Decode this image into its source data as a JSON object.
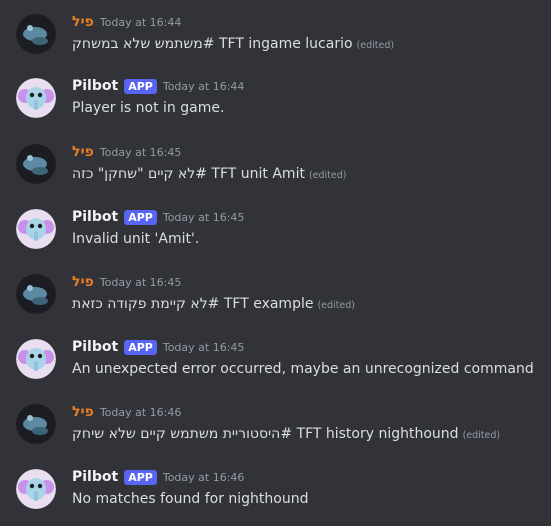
{
  "messages": [
    {
      "author": "פיל",
      "author_type": "user",
      "timestamp": "Today at 16:44",
      "text": "TFT ingame lucario  #משתמש שלא במשחק",
      "edited": "(edited)"
    },
    {
      "author": "Pilbot",
      "author_type": "bot",
      "badge": "APP",
      "timestamp": "Today at 16:44",
      "text": "Player is not in game."
    },
    {
      "author": "פיל",
      "author_type": "user",
      "timestamp": "Today at 16:45",
      "text": "TFT unit Amit    #לא קיים \"שחקן\" כזה",
      "edited": "(edited)"
    },
    {
      "author": "Pilbot",
      "author_type": "bot",
      "badge": "APP",
      "timestamp": "Today at 16:45",
      "text": "Invalid unit 'Amit'."
    },
    {
      "author": "פיל",
      "author_type": "user",
      "timestamp": "Today at 16:45",
      "text": "TFT example  #לא קיימת פקודה כזאת",
      "edited": "(edited)"
    },
    {
      "author": "Pilbot",
      "author_type": "bot",
      "badge": "APP",
      "timestamp": "Today at 16:45",
      "text": "An unexpected error occurred, maybe an unrecognized command"
    },
    {
      "author": "פיל",
      "author_type": "user",
      "timestamp": "Today at 16:46",
      "text": "TFT history nighthound  #היסטוריית משתמש קיים שלא שיחק",
      "edited": "(edited)"
    },
    {
      "author": "Pilbot",
      "author_type": "bot",
      "badge": "APP",
      "timestamp": "Today at 16:46",
      "text": "No matches found for nighthound"
    }
  ],
  "colors": {
    "background": "#313338",
    "user_name": "#e67e22",
    "bot_name": "#f2f3f5",
    "app_badge": "#5865f2",
    "timestamp": "#949ba4",
    "text": "#dbdee1"
  },
  "icons": {
    "user_avatar": "dark-photo-avatar",
    "bot_avatar": "elephant-bot-avatar"
  }
}
